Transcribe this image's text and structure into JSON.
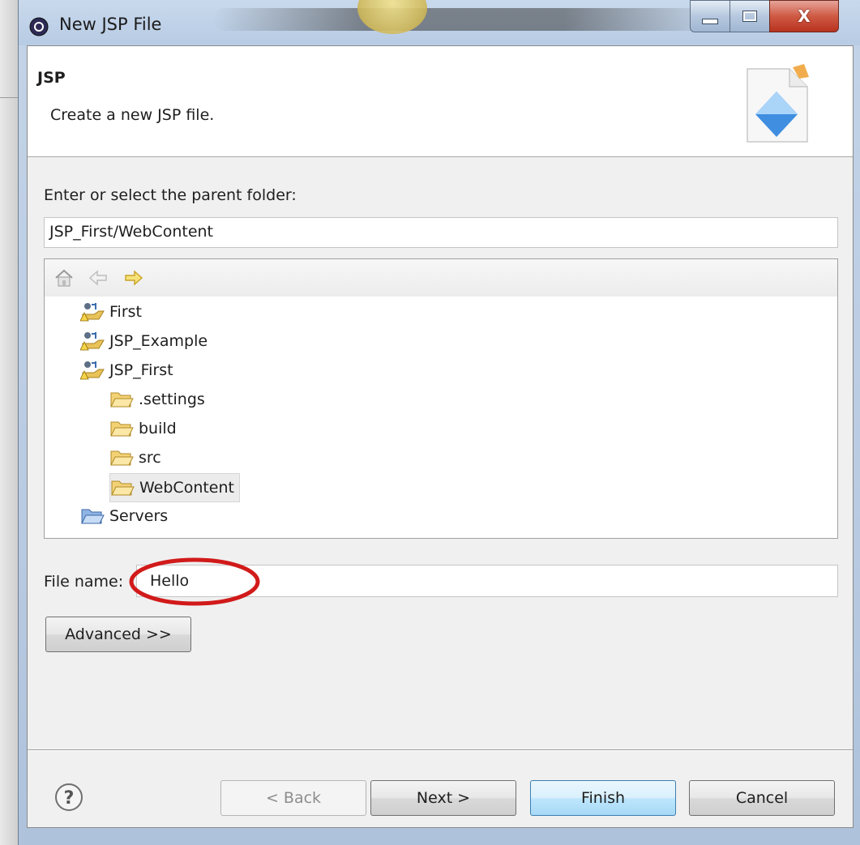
{
  "window": {
    "title": "New JSP File",
    "controls": {
      "minimize": "—",
      "maximize": "□",
      "close": "X"
    }
  },
  "banner": {
    "title": "JSP",
    "description": "Create a new JSP file."
  },
  "folder": {
    "label": "Enter or select the parent folder:",
    "value": "JSP_First/WebContent"
  },
  "tree": {
    "toolbar": [
      "home-icon",
      "back-arrow-icon",
      "forward-arrow-icon"
    ],
    "items": [
      {
        "label": "First",
        "type": "project",
        "level": 0
      },
      {
        "label": "JSP_Example",
        "type": "project",
        "level": 0
      },
      {
        "label": "JSP_First",
        "type": "project",
        "level": 0
      },
      {
        "label": ".settings",
        "type": "folder",
        "level": 1
      },
      {
        "label": "build",
        "type": "folder",
        "level": 1
      },
      {
        "label": "src",
        "type": "folder",
        "level": 1
      },
      {
        "label": "WebContent",
        "type": "folder",
        "level": 1,
        "selected": true
      },
      {
        "label": "Servers",
        "type": "servers-folder",
        "level": 0
      }
    ]
  },
  "file": {
    "label": "File name:",
    "value": "Hello",
    "annotation_color": "#d11a1a"
  },
  "buttons": {
    "advanced": "Advanced >>",
    "back": "< Back",
    "next": "Next >",
    "finish": "Finish",
    "cancel": "Cancel",
    "help": "?"
  }
}
